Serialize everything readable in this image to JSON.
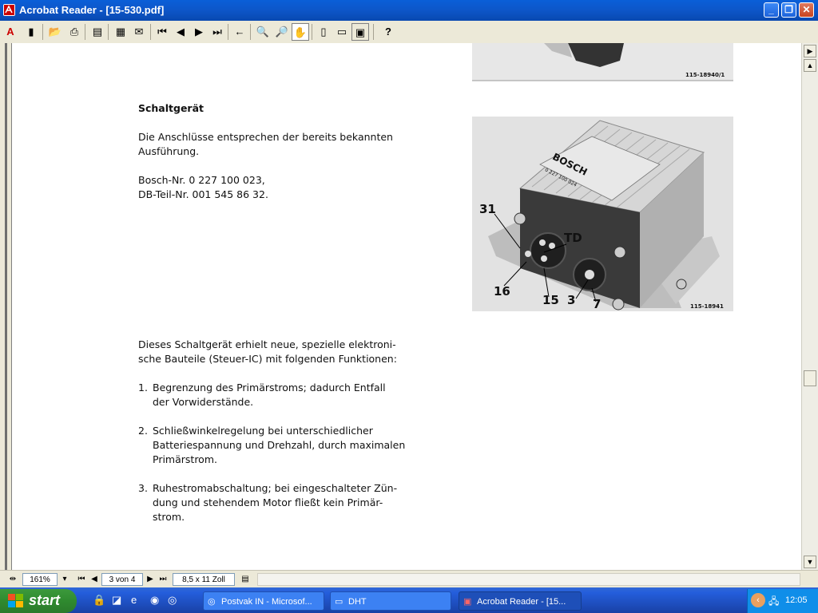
{
  "window": {
    "title": "Acrobat Reader - [15-530.pdf]",
    "min_icon": "minimize-icon",
    "max_icon": "restore-icon",
    "close_icon": "close-icon"
  },
  "toolbar": {
    "items": [
      "acrobat-logo-icon",
      "toggle-bookmarks-icon",
      "open-icon",
      "print-icon",
      "show-thumbnails-icon",
      "save-icon",
      "email-icon",
      "first-page-icon",
      "previous-page-icon",
      "next-page-icon",
      "last-page-icon",
      "go-back-icon",
      "zoom-out-icon",
      "zoom-in-icon",
      "hand-tool-icon",
      "actual-size-icon",
      "fit-page-icon",
      "fit-width-icon",
      "help-icon"
    ]
  },
  "document": {
    "caption_top": "115-18940/1",
    "heading": "Schaltgerät",
    "para1_line1": "Die Anschlüsse entsprechen der bereits bekannten",
    "para1_line2": "Ausführung.",
    "bosch_nr": "Bosch-Nr. 0 227 100 023,",
    "db_nr": "DB-Teil-Nr. 001 545 86 32.",
    "photo": {
      "brand": "BOSCH",
      "part_no": "0 227 100 024",
      "labels": [
        "31",
        "TD",
        "16",
        "15",
        "3",
        "7"
      ],
      "caption": "115-18941"
    },
    "intro_line1": "Dieses Schaltgerät erhielt neue, spezielle elektroni-",
    "intro_line2": "sche Bauteile (Steuer-IC) mit folgenden Funktionen:",
    "list": [
      {
        "num": "1.",
        "lines": [
          "Begrenzung des Primärstroms; dadurch Entfall",
          "der Vorwiderstände."
        ]
      },
      {
        "num": "2.",
        "lines": [
          "Schließwinkelregelung bei unterschiedlicher",
          "Batteriespannung und Drehzahl, durch maximalen",
          "Primärstrom."
        ]
      },
      {
        "num": "3.",
        "lines": [
          "Ruhestromabschaltung; bei eingeschalteter Zün-",
          "dung und stehendem Motor fließt kein Primär-",
          "strom."
        ]
      }
    ]
  },
  "statusbar": {
    "zoom": "161%",
    "page": "3 von 4",
    "size": "8,5 x 11 Zoll"
  },
  "taskbar": {
    "start": "start",
    "tasks": [
      {
        "label": "Postvak IN - Microsof...",
        "icon": "outlook-icon"
      },
      {
        "label": "DHT",
        "icon": "folder-icon"
      },
      {
        "label": "Acrobat Reader - [15...",
        "icon": "acrobat-icon"
      }
    ],
    "clock": "12:05"
  },
  "colors": {
    "titlebar": "#0a5fd8",
    "taskbar": "#245edc",
    "start": "#2f8a2f",
    "toolbar": "#ece9d8"
  }
}
